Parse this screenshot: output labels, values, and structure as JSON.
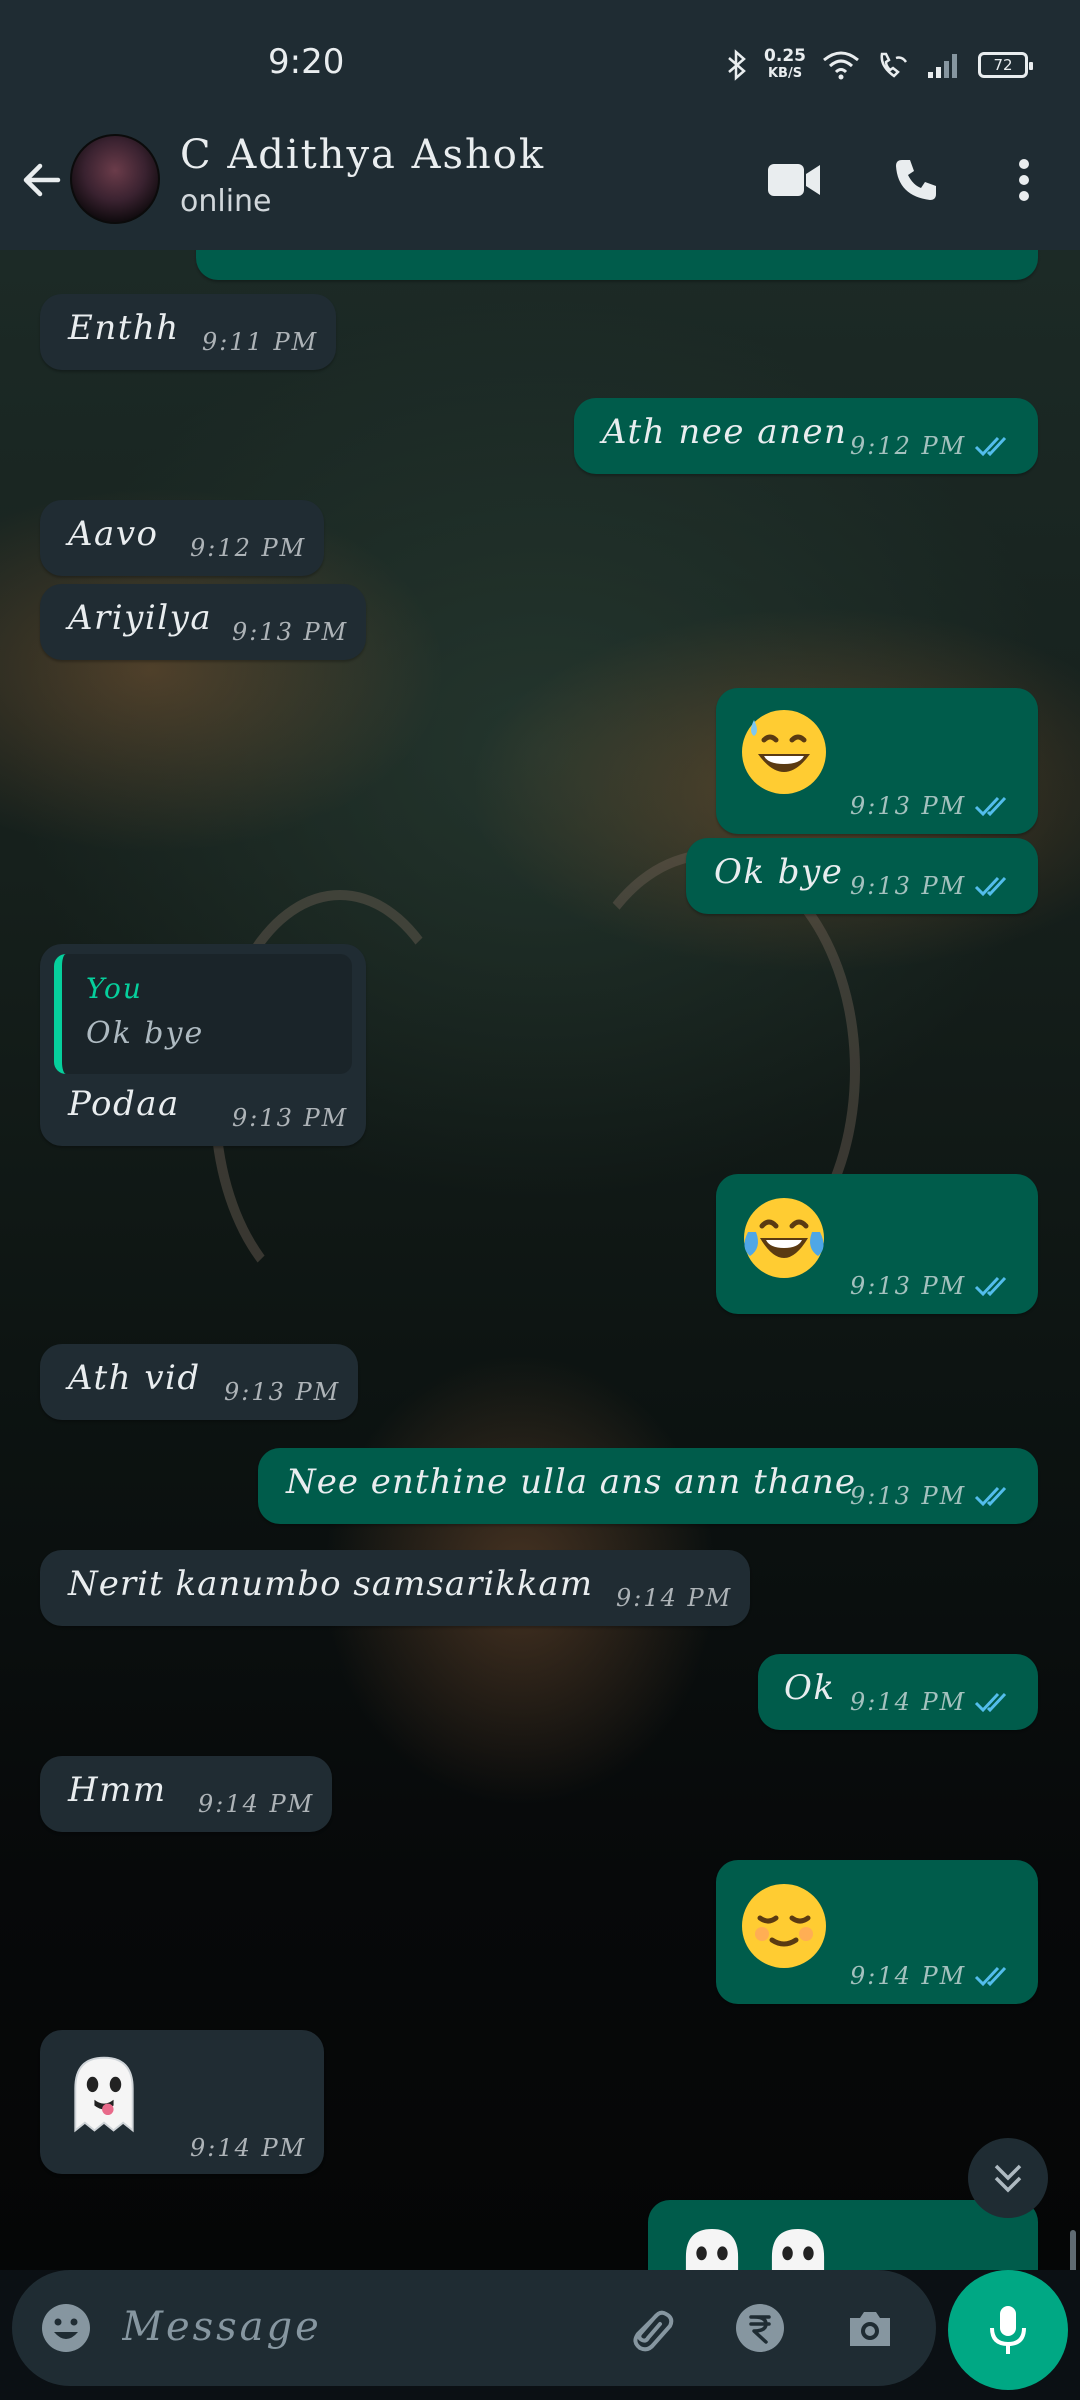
{
  "status_bar": {
    "time": "9:20",
    "net_speed_value": "0.25",
    "net_speed_unit": "KB/S",
    "battery": "72"
  },
  "header": {
    "contact_name": "C Adithya Ashok",
    "contact_status": "online"
  },
  "messages": [
    {
      "dir": "in",
      "text": "Enthh",
      "time": "9:11 PM"
    },
    {
      "dir": "out",
      "text": "Ath nee anen",
      "time": "9:12 PM"
    },
    {
      "dir": "in",
      "text": "Aavo",
      "time": "9:12 PM"
    },
    {
      "dir": "in",
      "text": "Ariyilya",
      "time": "9:13 PM"
    },
    {
      "dir": "out",
      "emoji": "grinning-sweat-emoji",
      "time": "9:13 PM"
    },
    {
      "dir": "out",
      "text": "Ok bye",
      "time": "9:13 PM"
    },
    {
      "dir": "in",
      "reply_name": "You",
      "reply_text": "Ok bye",
      "text": "Podaa",
      "time": "9:13 PM"
    },
    {
      "dir": "out",
      "emoji": "tears-of-joy-emoji",
      "time": "9:13 PM"
    },
    {
      "dir": "in",
      "text": "Ath vid",
      "time": "9:13 PM"
    },
    {
      "dir": "out",
      "text": "Nee enthine ulla ans ann thane",
      "time": "9:13 PM"
    },
    {
      "dir": "in",
      "text": "Nerit kanumbo samsarikkam",
      "time": "9:14 PM"
    },
    {
      "dir": "out",
      "text": "Ok",
      "time": "9:14 PM"
    },
    {
      "dir": "in",
      "text": "Hmm",
      "time": "9:14 PM"
    },
    {
      "dir": "out",
      "emoji": "relieved-face-emoji",
      "time": "9:14 PM"
    },
    {
      "dir": "in",
      "emoji": "ghost-emoji",
      "time": "9:14 PM"
    },
    {
      "dir": "out",
      "emoji": "ghost-emoji",
      "time": ""
    }
  ],
  "input": {
    "placeholder": "Message"
  },
  "colors": {
    "incoming_bubble": "#202c33",
    "outgoing_bubble": "#005c4b",
    "accent": "#00a884",
    "read_ticks": "#53bdeb"
  }
}
